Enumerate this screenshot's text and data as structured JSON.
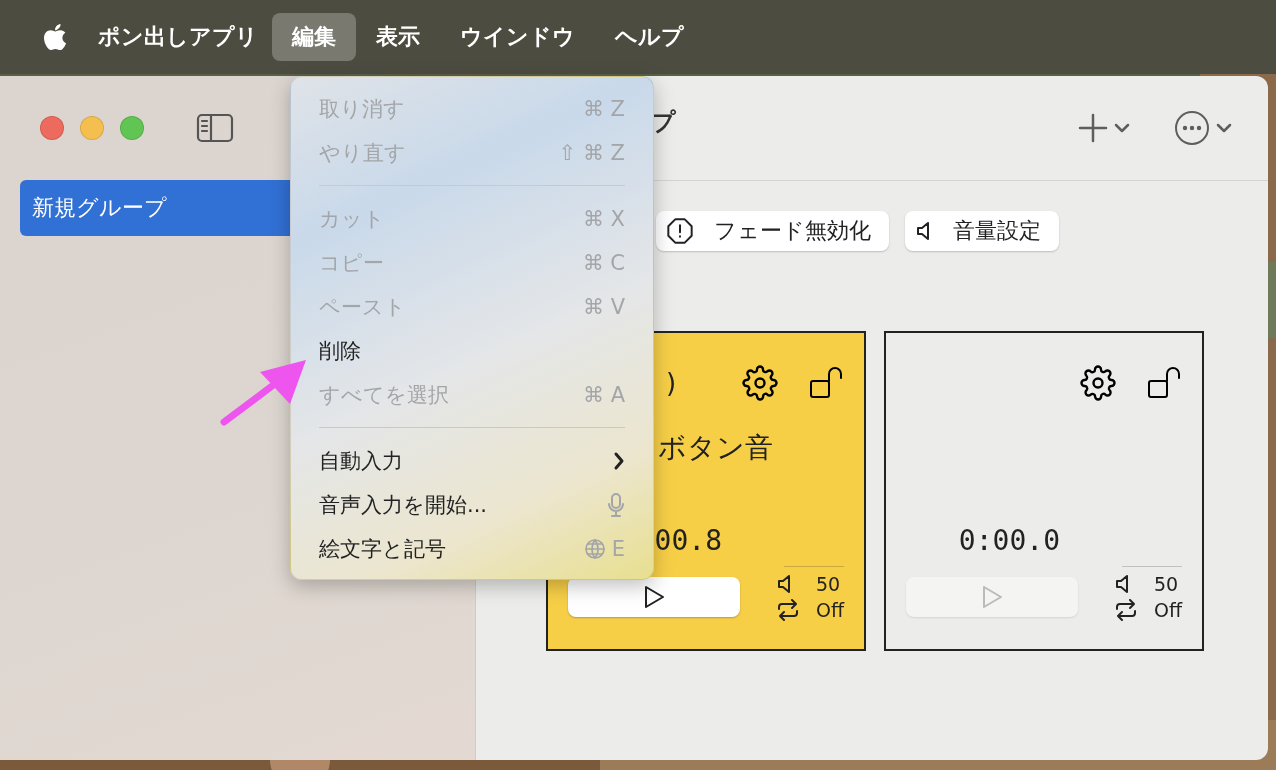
{
  "menu_bar": {
    "app_name": "ポン出しアプリ",
    "items": [
      {
        "label": "編集",
        "selected": true
      },
      {
        "label": "表示",
        "selected": false
      },
      {
        "label": "ウインドウ",
        "selected": false
      },
      {
        "label": "ヘルプ",
        "selected": false
      }
    ]
  },
  "sidebar": {
    "items": [
      {
        "label": "新規グループ",
        "selected": true
      }
    ]
  },
  "window": {
    "title": "プ"
  },
  "toolbar_buttons": [
    {
      "kind": "fade",
      "label": "フェード無効化"
    },
    {
      "kind": "volume",
      "label": "音量設定"
    }
  ],
  "cards": [
    {
      "selected": true,
      "label": ")",
      "name": "ボタン音",
      "time": "00.8",
      "volume": "50",
      "loop": "Off",
      "playable": true
    },
    {
      "selected": false,
      "time": "0:00.0",
      "volume": "50",
      "loop": "Off",
      "playable": false
    }
  ],
  "edit_menu": {
    "items": [
      {
        "kind": "item",
        "label": "取り消す",
        "shortcut": "⌘ Z",
        "disabled": true
      },
      {
        "kind": "item",
        "label": "やり直す",
        "shortcut": "⇧ ⌘ Z",
        "disabled": true
      },
      {
        "kind": "separator"
      },
      {
        "kind": "item",
        "label": "カット",
        "shortcut": "⌘ X",
        "disabled": true
      },
      {
        "kind": "item",
        "label": "コピー",
        "shortcut": "⌘ C",
        "disabled": true
      },
      {
        "kind": "item",
        "label": "ペースト",
        "shortcut": "⌘ V",
        "disabled": true
      },
      {
        "kind": "item",
        "label": "削除",
        "disabled": false
      },
      {
        "kind": "item",
        "label": "すべてを選択",
        "shortcut": "⌘ A",
        "disabled": true
      },
      {
        "kind": "separator"
      },
      {
        "kind": "submenu",
        "label": "自動入力",
        "disabled": false
      },
      {
        "kind": "dictation",
        "label": "音声入力を開始...",
        "disabled": false
      },
      {
        "kind": "emoji",
        "label": "絵文字と記号",
        "shortcut": "E",
        "disabled": false
      }
    ]
  }
}
